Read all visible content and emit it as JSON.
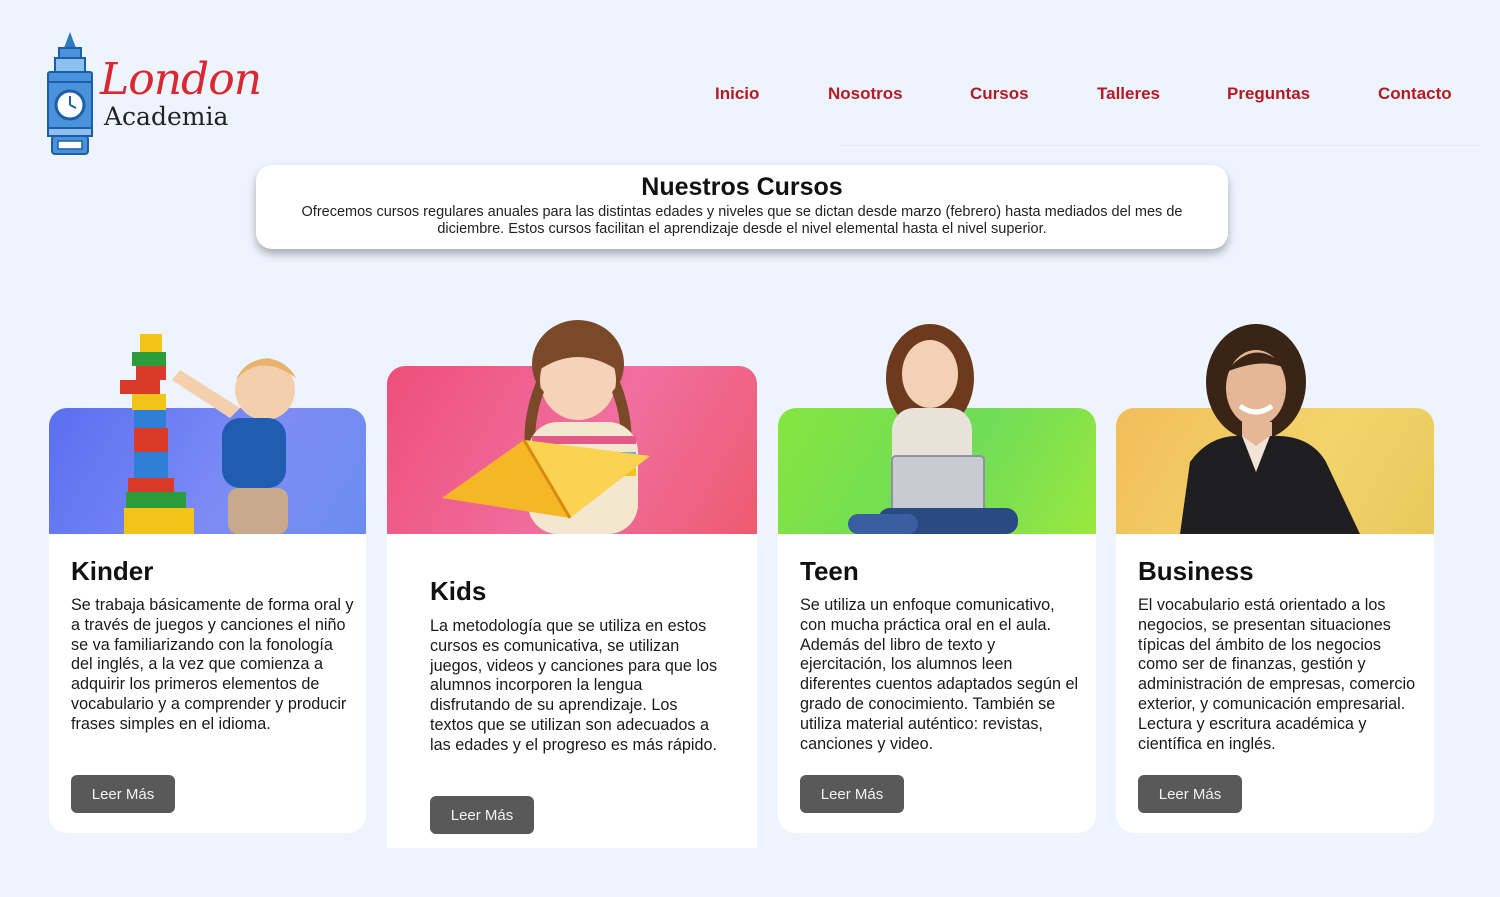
{
  "brand": {
    "script": "London",
    "word": "Academia"
  },
  "nav": [
    "Inicio",
    "Nosotros",
    "Cursos",
    "Talleres",
    "Preguntas",
    "Contacto"
  ],
  "intro": {
    "title": "Nuestros Cursos",
    "text": "Ofrecemos cursos regulares anuales para las distintas edades y niveles que se dictan desde marzo (febrero) hasta mediados del mes de diciembre. Estos cursos facilitan el aprendizaje desde el nivel elemental hasta el nivel superior."
  },
  "cards": [
    {
      "title": "Kinder",
      "text": "Se trabaja básicamente de forma oral y a través de juegos y canciones el niño se va familiarizando con la fonología del inglés, a la vez que comienza a adquirir los primeros elementos de vocabulario y a comprender y producir frases simples en el idioma.",
      "button": "Leer Más",
      "color": "#6478f2"
    },
    {
      "title": "Kids",
      "text": "La metodología que se utiliza en estos cursos es comunicativa, se utilizan juegos, videos y canciones para que los alumnos incorporen la lengua disfrutando de su aprendizaje. Los textos que se utilizan son adecuados a las edades y el progreso es más rápido.",
      "button": "Leer Más",
      "color": "#f0527e"
    },
    {
      "title": "Teen",
      "text": "Se utiliza un enfoque comunicativo, con mucha práctica oral en el aula. Además del libro de texto y ejercitación, los alumnos leen diferentes cuentos adaptados según el grado de conocimiento. También se utiliza material auténtico: revistas, canciones y video.",
      "button": "Leer Más",
      "color": "#7fe04a"
    },
    {
      "title": "Business",
      "text": "El vocabulario está orientado a los negocios, se presentan situaciones típicas del ámbito de los negocios como ser de finanzas, gestión y administración de empresas, comercio exterior, y comunicación empresarial. Lectura y escritura académica y científica en inglés.",
      "button": "Leer Más",
      "color": "#f0c656"
    }
  ]
}
